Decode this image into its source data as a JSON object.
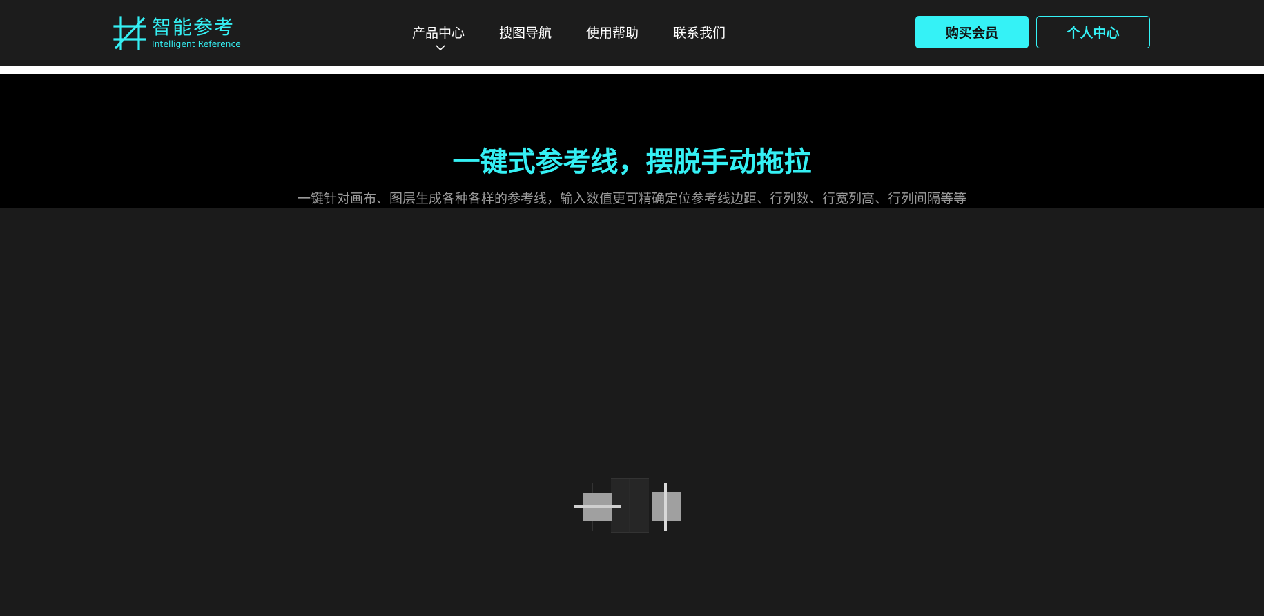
{
  "header": {
    "logo": {
      "title": "智能参考",
      "subtitle": "Intelligent Reference",
      "accent": "#35f0f4"
    },
    "nav": [
      {
        "label": "产品中心",
        "has_dropdown": true
      },
      {
        "label": "搜图导航",
        "has_dropdown": false
      },
      {
        "label": "使用帮助",
        "has_dropdown": false
      },
      {
        "label": "联系我们",
        "has_dropdown": false
      }
    ],
    "buttons": {
      "buy_label": "购买会员",
      "personal_label": "个人中心"
    }
  },
  "hero": {
    "title": "一键式参考线，摆脱手动拖拉",
    "subtitle": "一键针对画布、图层生成各种各样的参考线，输入数值更可精确定位参考线边距、行列数、行宽列高、行列间隔等等"
  },
  "icons": {
    "logo_mark": "hashtag-grid-logo-icon",
    "nav_dropdown": "chevron-down-icon",
    "loader": "guide-lines-illustration-icon"
  }
}
